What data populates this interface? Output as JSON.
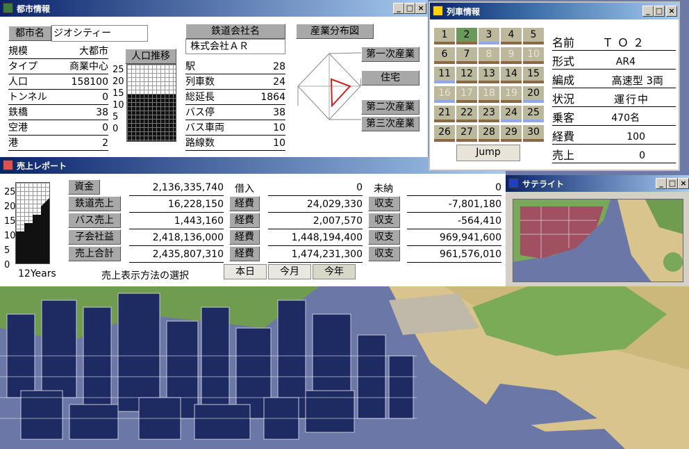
{
  "city_window": {
    "title": "都市情報",
    "city_name_label": "都市名",
    "city_name": "ジオシティー",
    "stats": [
      {
        "label": "規模",
        "value": "大都市"
      },
      {
        "label": "タイプ",
        "value": "商業中心"
      },
      {
        "label": "人口",
        "value": "158100"
      },
      {
        "label": "トンネル",
        "value": "0"
      },
      {
        "label": "鉄橋",
        "value": "38"
      },
      {
        "label": "空港",
        "value": "0"
      },
      {
        "label": "港",
        "value": "2"
      }
    ],
    "pop_chart_label": "人口推移",
    "pop_axis": [
      "25",
      "20",
      "15",
      "10",
      "5",
      "0"
    ],
    "pop_level": 0.62,
    "rail_company_label": "鉄道会社名",
    "rail_company": "株式会社ＡＲ",
    "rail_stats": [
      {
        "label": "駅",
        "value": "28"
      },
      {
        "label": "列車数",
        "value": "24"
      },
      {
        "label": "総延長",
        "value": "1864"
      },
      {
        "label": "バス停",
        "value": "38"
      },
      {
        "label": "バス車両",
        "value": "10"
      },
      {
        "label": "路線数",
        "value": "10"
      }
    ],
    "industry_button": "産業分布図",
    "industry_labels": [
      "第一次産業",
      "住宅",
      "第二次産業",
      "第三次産業"
    ]
  },
  "train_window": {
    "title": "列車情報",
    "cells": [
      "1",
      "2",
      "3",
      "4",
      "5",
      "6",
      "7",
      "8",
      "9",
      "10",
      "11",
      "12",
      "13",
      "14",
      "15",
      "16",
      "17",
      "18",
      "19",
      "20",
      "21",
      "22",
      "23",
      "24",
      "25",
      "26",
      "27",
      "28",
      "29",
      "30"
    ],
    "jump": "Jump",
    "info": [
      {
        "label": "名前",
        "value": "ＴＯ２"
      },
      {
        "label": "形式",
        "value": "AR4"
      },
      {
        "label": "編成",
        "value": "高速型 3両"
      },
      {
        "label": "状況",
        "value": "運行中"
      },
      {
        "label": "乗客",
        "value": "470名"
      },
      {
        "label": "経費",
        "value": "100"
      },
      {
        "label": "売上",
        "value": "0"
      }
    ]
  },
  "sales_window": {
    "title": "売上レポート",
    "axis": [
      "25",
      "20",
      "15",
      "10",
      "5",
      "0"
    ],
    "years_label": "12Years",
    "col1_labels": [
      "資金",
      "鉄道売上",
      "バス売上",
      "子会社益",
      "売上合計"
    ],
    "col1_values": [
      "2,136,335,740",
      "16,228,150",
      "1,443,160",
      "2,418,136,000",
      "2,435,807,310"
    ],
    "col2_labels": [
      "借入",
      "経費",
      "経費",
      "経費",
      "経費"
    ],
    "col2_values": [
      "0",
      "24,029,330",
      "2,007,570",
      "1,448,194,400",
      "1,474,231,300"
    ],
    "col3_labels": [
      "未納",
      "収支",
      "収支",
      "収支",
      "収支"
    ],
    "col3_values": [
      "0",
      "-7,801,180",
      "-564,410",
      "969,941,600",
      "961,576,010"
    ],
    "mode_label": "売上表示方法の選択",
    "modes": [
      "本日",
      "今月",
      "今年"
    ]
  },
  "satellite_window": {
    "title": "サテライト"
  }
}
